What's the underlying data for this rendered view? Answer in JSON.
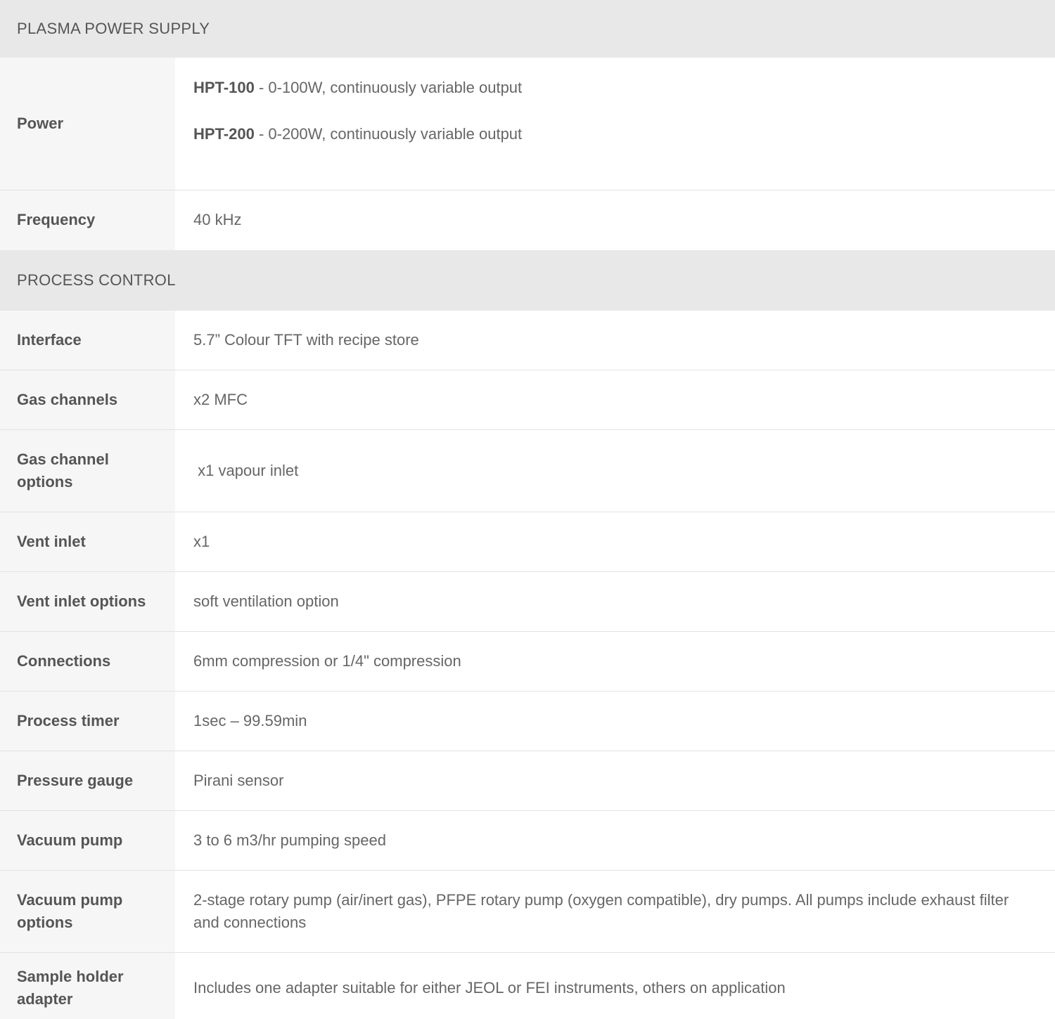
{
  "sections": {
    "plasma_power_supply": "PLASMA POWER SUPPLY",
    "process_control": "PROCESS CONTROL"
  },
  "power": {
    "label": "Power",
    "lines": [
      {
        "model": "HPT-100",
        "text": " - 0-100W, continuously variable output"
      },
      {
        "model": "HPT-200",
        "text": " - 0-200W, continuously variable output"
      }
    ]
  },
  "frequency": {
    "label": "Frequency",
    "value": "40 kHz"
  },
  "rows": [
    {
      "label": "Interface",
      "value": "5.7” Colour TFT with recipe store"
    },
    {
      "label": "Gas channels",
      "value": "x2 MFC"
    },
    {
      "label": "Gas channel options",
      "value": " x1 vapour inlet"
    },
    {
      "label": "Vent inlet",
      "value": "x1"
    },
    {
      "label": "Vent inlet options",
      "value": "soft ventilation option"
    },
    {
      "label": "Connections",
      "value": "6mm compression or 1/4\" compression"
    },
    {
      "label": "Process timer",
      "value": "1sec – 99.59min"
    },
    {
      "label": "Pressure gauge",
      "value": "Pirani sensor"
    },
    {
      "label": "Vacuum pump",
      "value": "3 to 6 m3/hr pumping speed"
    },
    {
      "label": "Vacuum pump options",
      "value": "2-stage rotary pump (air/inert gas), PFPE rotary pump (oxygen compatible), dry pumps. All pumps include exhaust filter and connections"
    },
    {
      "label": "Sample holder adapter",
      "value": "Includes one adapter suitable for either JEOL or FEI instruments, others on application"
    }
  ]
}
